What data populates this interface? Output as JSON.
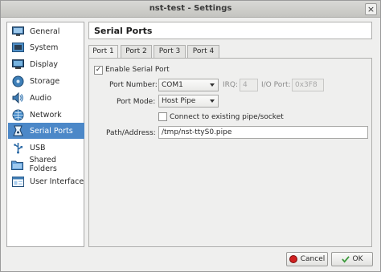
{
  "window": {
    "title": "nst-test - Settings",
    "close_glyph": "×"
  },
  "sidebar": {
    "items": [
      {
        "label": "General",
        "icon": "monitor-icon"
      },
      {
        "label": "System",
        "icon": "chip-icon"
      },
      {
        "label": "Display",
        "icon": "display-icon"
      },
      {
        "label": "Storage",
        "icon": "disk-icon"
      },
      {
        "label": "Audio",
        "icon": "speaker-icon"
      },
      {
        "label": "Network",
        "icon": "network-icon"
      },
      {
        "label": "Serial Ports",
        "icon": "serial-port-icon",
        "selected": true
      },
      {
        "label": "USB",
        "icon": "usb-icon"
      },
      {
        "label": "Shared Folders",
        "icon": "folder-icon"
      },
      {
        "label": "User Interface",
        "icon": "window-icon"
      }
    ]
  },
  "page": {
    "heading": "Serial Ports"
  },
  "tabs": [
    {
      "label": "Port 1",
      "active": true
    },
    {
      "label": "Port 2"
    },
    {
      "label": "Port 3"
    },
    {
      "label": "Port 4"
    }
  ],
  "form": {
    "enable_label": "Enable Serial Port",
    "enable_checked": true,
    "check_glyph": "✓",
    "port_number_label": "Port Number:",
    "port_number_value": "COM1",
    "irq_label": "IRQ:",
    "irq_value": "4",
    "io_port_label": "I/O Port:",
    "io_port_value": "0x3F8",
    "port_mode_label": "Port Mode:",
    "port_mode_value": "Host Pipe",
    "connect_existing_label": "Connect to existing pipe/socket",
    "connect_existing_checked": false,
    "path_label": "Path/Address:",
    "path_value": "/tmp/nst-ttyS0.pipe"
  },
  "buttons": {
    "cancel_label": "Cancel",
    "ok_label": "OK"
  },
  "colors": {
    "selection": "#4c88c8",
    "cancel_icon": "#d02020",
    "ok_icon": "#3c9a3c"
  }
}
